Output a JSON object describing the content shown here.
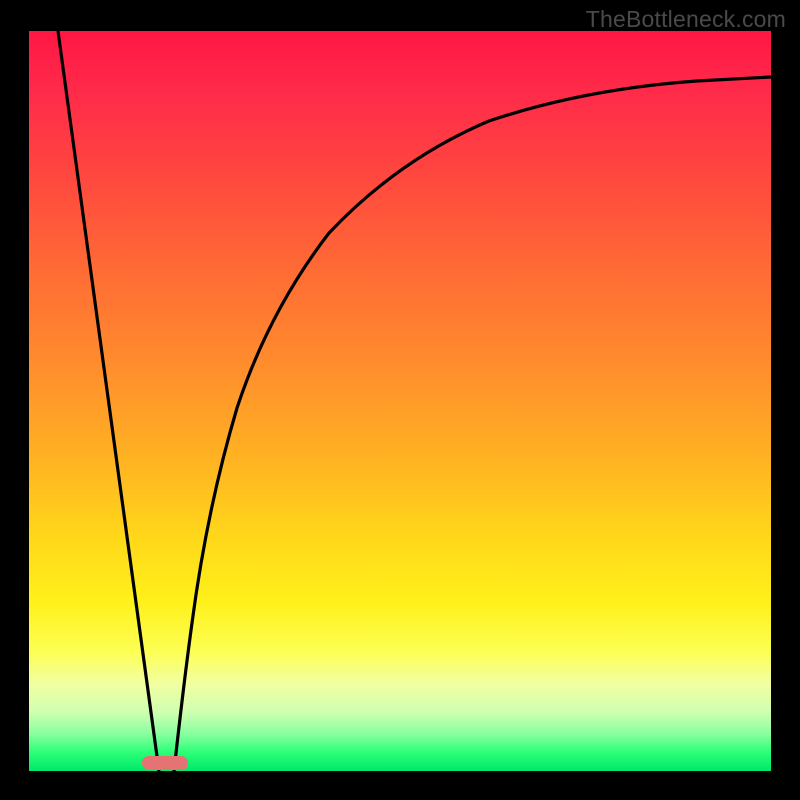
{
  "watermark": "TheBottleneck.com",
  "colors": {
    "frame": "#000000",
    "gradient_top": "#ff1744",
    "gradient_mid1": "#ff8f2c",
    "gradient_mid2": "#fff01a",
    "gradient_bottom": "#00e86a",
    "curve": "#000000",
    "marker": "#e57373",
    "watermark_text": "#4a4a4a"
  },
  "chart_data": {
    "type": "line",
    "title": "",
    "xlabel": "",
    "ylabel": "",
    "xlim": [
      0,
      100
    ],
    "ylim": [
      0,
      100
    ],
    "series": [
      {
        "name": "left-descent",
        "x": [
          3.9,
          17.5
        ],
        "values": [
          100,
          0
        ]
      },
      {
        "name": "right-curve",
        "x": [
          19.5,
          22,
          25,
          28,
          32,
          37,
          43,
          50,
          58,
          68,
          80,
          90,
          100
        ],
        "values": [
          0,
          20,
          37,
          49,
          59,
          67,
          73,
          78,
          82.5,
          86,
          89,
          90.5,
          91.8
        ]
      }
    ],
    "annotations": [
      {
        "name": "bottleneck-marker",
        "x": 18,
        "y": 0.5
      }
    ]
  }
}
